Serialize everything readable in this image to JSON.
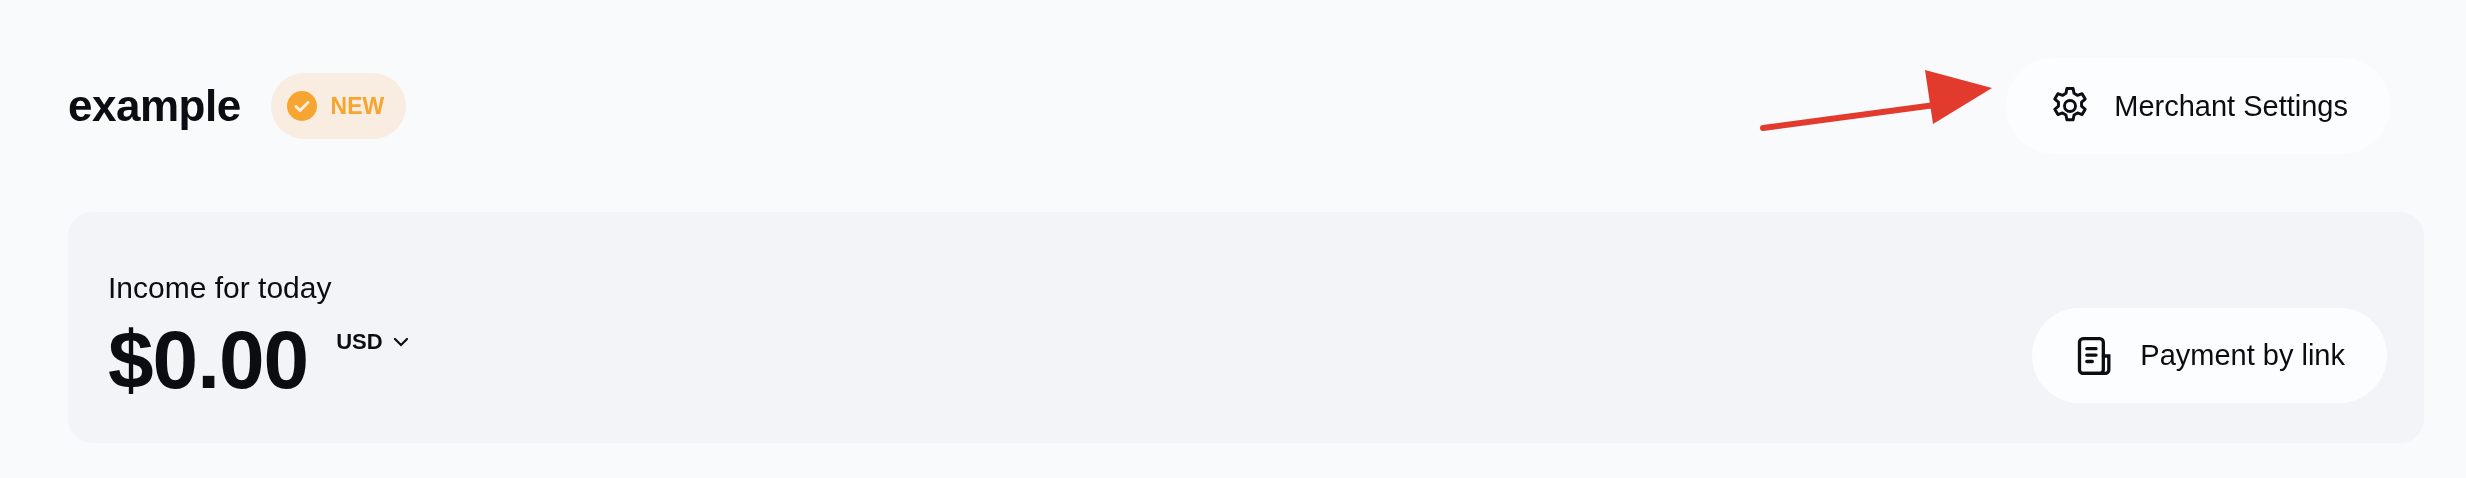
{
  "header": {
    "title": "example",
    "badge": {
      "label": "NEW",
      "color": "#f6a630"
    },
    "settings_button": "Merchant Settings"
  },
  "income_card": {
    "label": "Income for today",
    "amount": "$0.00",
    "currency": "USD",
    "payment_button": "Payment by link"
  }
}
